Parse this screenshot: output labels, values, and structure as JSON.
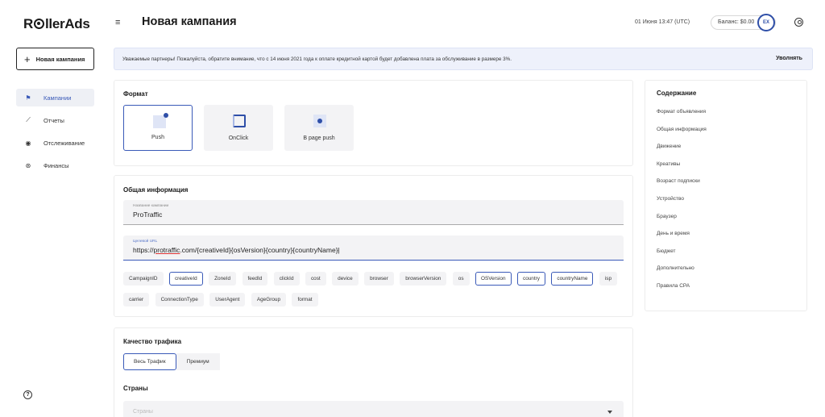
{
  "brand": {
    "name_prefix": "R",
    "name_suffix": "llerAds"
  },
  "sidebar": {
    "new_campaign_label": "Новая кампания",
    "items": [
      {
        "label": "Кампании",
        "icon": "flag-icon",
        "active": true
      },
      {
        "label": "Отчеты",
        "icon": "chart-icon",
        "active": false
      },
      {
        "label": "Отслеживание",
        "icon": "tracking-icon",
        "active": false
      },
      {
        "label": "Финансы",
        "icon": "finance-icon",
        "active": false
      }
    ]
  },
  "header": {
    "title": "Новая кампания",
    "datetime": "01 Июня 13:47 (UTC)",
    "balance": "Баланс: $0.00",
    "balance_badge": "EX"
  },
  "notice": {
    "text": "Уважаемые партнеры! Пожалуйста, обратите внимание, что с 14 июня 2021 года к оплате кредитной картой будет добавлена плата за обслуживание в размере 3%.",
    "dismiss": "Уволнять"
  },
  "format": {
    "title": "Формат",
    "options": [
      {
        "label": "Push",
        "selected": true
      },
      {
        "label": "OnClick",
        "selected": false
      },
      {
        "label": "В page push",
        "selected": false
      }
    ]
  },
  "general": {
    "title": "Общая информация",
    "name_label": "Название кампании",
    "name_value": "ProTraffic",
    "url_label": "Целевой URL",
    "url_prefix": "https://",
    "url_domain": "protraffic",
    "url_rest": ".com/{creativeId}{osVersion}{country}{countryName}",
    "tags": [
      {
        "label": "CampaignID",
        "outlined": false
      },
      {
        "label": "creativeId",
        "outlined": true
      },
      {
        "label": "ZoneId",
        "outlined": false
      },
      {
        "label": "feedId",
        "outlined": false
      },
      {
        "label": "clickId",
        "outlined": false
      },
      {
        "label": "cost",
        "outlined": false
      },
      {
        "label": "device",
        "outlined": false
      },
      {
        "label": "browser",
        "outlined": false
      },
      {
        "label": "browserVersion",
        "outlined": false
      },
      {
        "label": "os",
        "outlined": false
      },
      {
        "label": "OSVersion",
        "outlined": true
      },
      {
        "label": "country",
        "outlined": true
      },
      {
        "label": "countryName",
        "outlined": true
      },
      {
        "label": "isp",
        "outlined": false
      },
      {
        "label": "carrier",
        "outlined": false
      },
      {
        "label": "ConnectionType",
        "outlined": false
      },
      {
        "label": "UserAgent",
        "outlined": false
      },
      {
        "label": "AgeGroup",
        "outlined": false
      },
      {
        "label": "format",
        "outlined": false
      }
    ]
  },
  "quality": {
    "title": "Качество трафика",
    "options": [
      {
        "label": "Весь Трафик",
        "active": true
      },
      {
        "label": "Премиум",
        "active": false
      }
    ],
    "countries_title": "Страны",
    "countries_placeholder": "Страны"
  },
  "contents": {
    "title": "Содержание",
    "items": [
      "Формат объявления",
      "Общая информация",
      "Движение",
      "Креативы",
      "Возраст подписки",
      "Устройство",
      "Браузер",
      "День и время",
      "Бюджет",
      "Дополнительно",
      "Правила CPA"
    ]
  },
  "colors": {
    "accent": "#3a5ab8",
    "notice_bg": "#eef1fb",
    "field_bg": "#f3f3f5"
  }
}
